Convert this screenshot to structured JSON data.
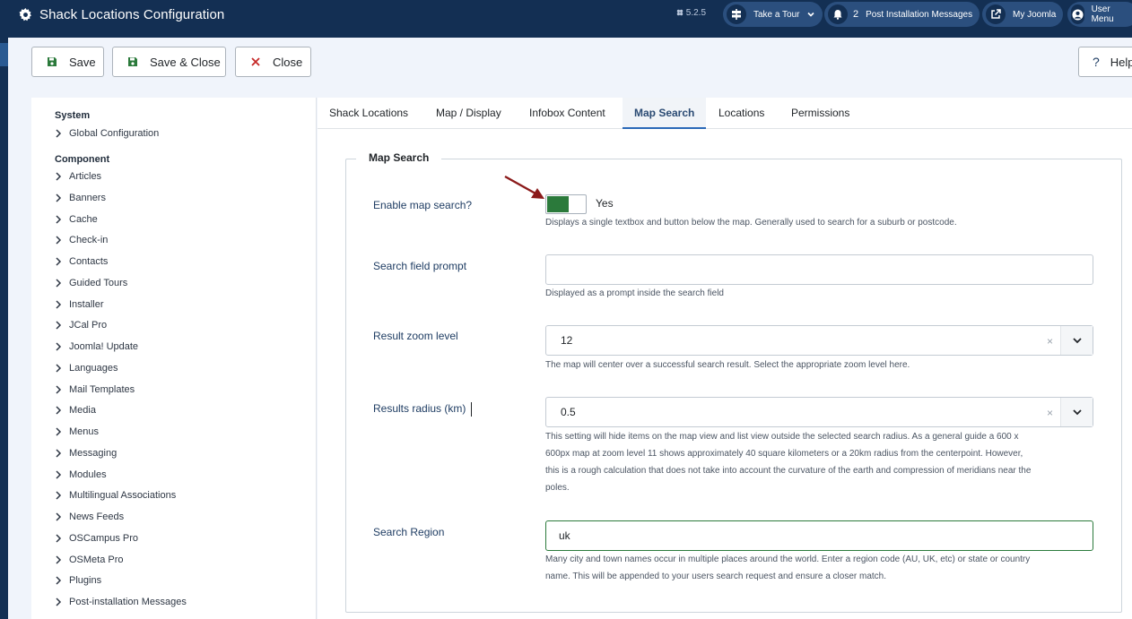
{
  "header": {
    "title": "Shack Locations Configuration",
    "version": "5.2.5",
    "take_tour": "Take a Tour",
    "post_install_count": "2",
    "post_install": "Post Installation Messages",
    "my_joomla": "My Joomla",
    "user_menu": "User Menu"
  },
  "toolbar": {
    "save": "Save",
    "save_close": "Save & Close",
    "close": "Close",
    "help": "Help"
  },
  "sidebar": {
    "system_heading": "System",
    "system_items": [
      "Global Configuration"
    ],
    "component_heading": "Component",
    "component_items": [
      "Articles",
      "Banners",
      "Cache",
      "Check-in",
      "Contacts",
      "Guided Tours",
      "Installer",
      "JCal Pro",
      "Joomla! Update",
      "Languages",
      "Mail Templates",
      "Media",
      "Menus",
      "Messaging",
      "Modules",
      "Multilingual Associations",
      "News Feeds",
      "OSCampus Pro",
      "OSMeta Pro",
      "Plugins",
      "Post-installation Messages"
    ]
  },
  "tabs": [
    "Shack Locations",
    "Map / Display",
    "Infobox Content",
    "Map Search",
    "Locations",
    "Permissions"
  ],
  "form": {
    "legend": "Map Search",
    "enable": {
      "label": "Enable map search?",
      "value": "Yes",
      "desc": "Displays a single textbox and button below the map. Generally used to search for a suburb or postcode."
    },
    "prompt": {
      "label": "Search field prompt",
      "value": "",
      "desc": "Displayed as a prompt inside the search field"
    },
    "zoom": {
      "label": "Result zoom level",
      "value": "12",
      "clear": "×",
      "desc": "The map will center over a successful search result. Select the appropriate zoom level here."
    },
    "radius": {
      "label": "Results radius (km)",
      "value": "0.5",
      "clear": "×",
      "desc_lines": [
        "This setting will hide items on the map view and list view outside the selected search radius. As a general guide a 600 x",
        "600px map at zoom level 11 shows approximately 40 square kilometers or a 20km radius from the centerpoint. However,",
        "this is a rough calculation that does not take into account the curvature of the earth and compression of meridians near the",
        "poles."
      ]
    },
    "region": {
      "label": "Search Region",
      "value": "uk",
      "desc_lines": [
        "Many city and town names occur in multiple places around the world. Enter a region code (AU, UK, etc) or state or country",
        "name. This will be appended to your users search request and ensure a closer match."
      ]
    }
  },
  "colors": {
    "header_bg": "#132f53",
    "toggle_on": "#2b7a3b",
    "annotation_arrow": "#8b1a1a",
    "active_tab": "#2a69b8"
  }
}
